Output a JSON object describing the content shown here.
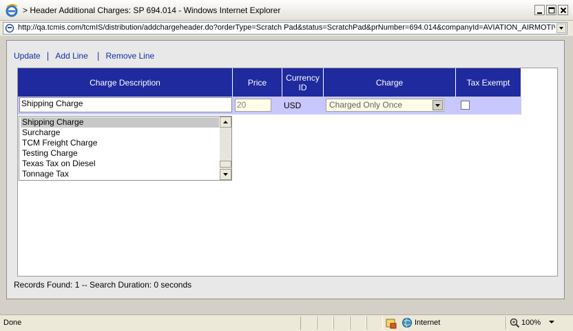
{
  "window": {
    "title": "> Header Additional Charges: SP 694.014 - Windows Internet Explorer"
  },
  "address": {
    "url": "http://qa.tcmis.com/tcmIS/distribution/addchargeheader.do?orderType=Scratch Pad&status=ScratchPad&prNumber=694.014&companyId=AVIATION_AIRMOTIVE"
  },
  "toolbar": {
    "update_label": "Update",
    "add_line_label": "Add Line",
    "remove_line_label": "Remove Line",
    "separator": "|"
  },
  "grid": {
    "columns": {
      "description": "Charge Description",
      "price": "Price",
      "currency_line1": "Currency",
      "currency_line2": "ID",
      "charge": "Charge",
      "tax_exempt": "Tax Exempt"
    },
    "row": {
      "description": "Shipping Charge",
      "price": "20",
      "currency": "USD",
      "charge": "Charged Only Once",
      "tax_exempt": false
    },
    "header_color": "#1e2a9e",
    "row_color": "#c8c8ff"
  },
  "dropdown_list": {
    "items": [
      "Shipping Charge",
      "Surcharge",
      "TCM Freight Charge",
      "Testing Charge",
      "Texas Tax on Diesel",
      "Tonnage Tax"
    ],
    "selected_index": 0
  },
  "footer": {
    "records_text": "Records Found: 1 -- Search Duration: 0 seconds"
  },
  "status": {
    "text": "Done",
    "zone": "Internet",
    "zoom": "100%"
  }
}
